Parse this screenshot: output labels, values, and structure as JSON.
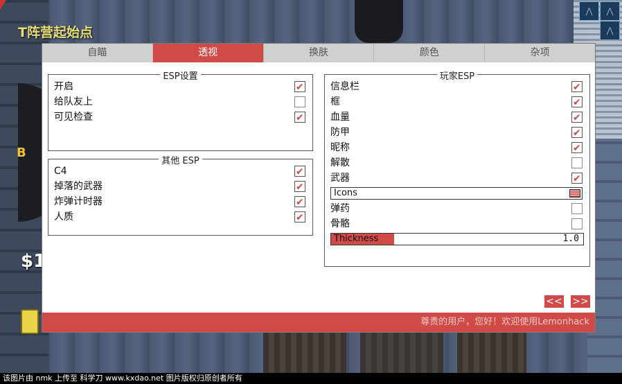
{
  "hud": {
    "spawn_title": "T阵营起始点",
    "bombsite": "B",
    "money": "$1"
  },
  "footer": {
    "text": "该图片由 nmk 上传至 科学刀 www.kxdao.net 图片版权归原创者所有"
  },
  "tabs": [
    {
      "label": "自瞄",
      "active": false
    },
    {
      "label": "透视",
      "active": true
    },
    {
      "label": "换肤",
      "active": false
    },
    {
      "label": "颜色",
      "active": false
    },
    {
      "label": "杂项",
      "active": false
    }
  ],
  "esp_settings": {
    "title": "ESP设置",
    "items": [
      {
        "label": "开启",
        "checked": true
      },
      {
        "label": "给队友上",
        "checked": false
      },
      {
        "label": "可见检查",
        "checked": true
      }
    ]
  },
  "other_esp": {
    "title": "其他 ESP",
    "items": [
      {
        "label": "C4",
        "checked": true
      },
      {
        "label": "掉落的武器",
        "checked": true
      },
      {
        "label": "炸弹计时器",
        "checked": true
      },
      {
        "label": "人质",
        "checked": true
      }
    ]
  },
  "player_esp": {
    "title": "玩家ESP",
    "items": [
      {
        "label": "信息栏",
        "checked": true
      },
      {
        "label": "框",
        "checked": true
      },
      {
        "label": "血量",
        "checked": true
      },
      {
        "label": "防甲",
        "checked": true
      },
      {
        "label": "昵称",
        "checked": true
      },
      {
        "label": "解散",
        "checked": false
      },
      {
        "label": "武器",
        "checked": true
      }
    ],
    "weapon_mode": "Icons",
    "items2": [
      {
        "label": "弹药",
        "checked": false
      },
      {
        "label": "骨骼",
        "checked": false
      }
    ],
    "thickness": {
      "label": "Thickness",
      "value": "1.0",
      "fraction": 0.25
    }
  },
  "nav": {
    "prev": "<<",
    "next": ">>"
  },
  "status_message": "尊贵的用户，您好！欢迎使用Lemonhack",
  "colors": {
    "accent": "#d04a48",
    "hud_title": "#e6dd7a"
  }
}
